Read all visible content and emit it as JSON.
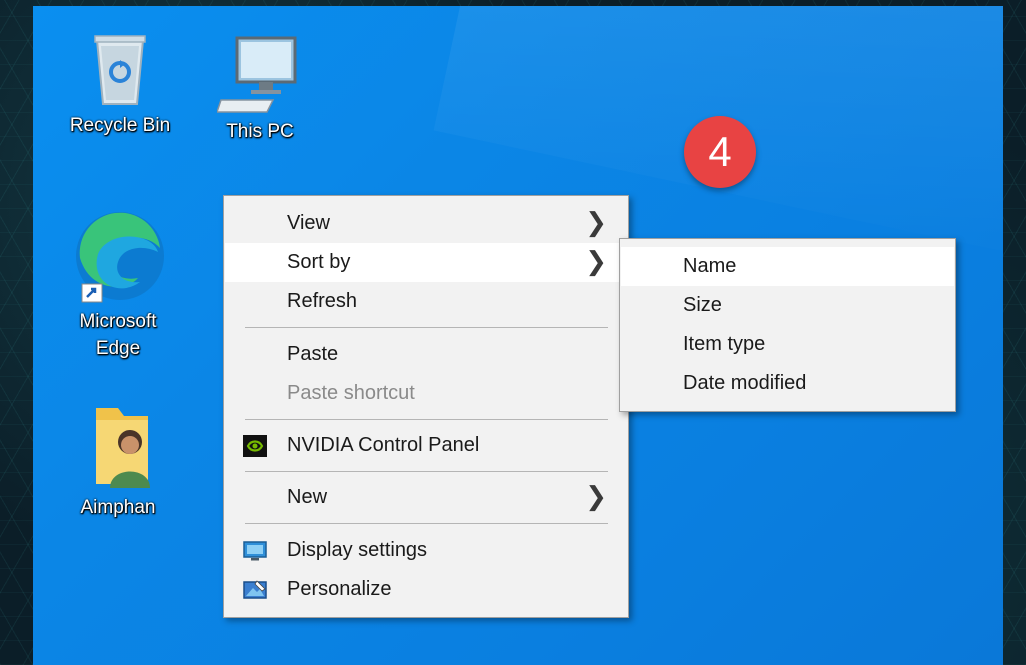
{
  "desktop_icons": [
    {
      "label": "Recycle Bin",
      "icon": "recycle-bin-icon"
    },
    {
      "label": "This PC",
      "icon": "computer-icon"
    },
    {
      "label": "Microsoft Edge",
      "icon": "edge-icon"
    },
    {
      "label": "Aimphan",
      "icon": "user-folder-icon"
    }
  ],
  "edge_label_line1": "Microsoft",
  "edge_label_line2": "Edge",
  "step_badge": "4",
  "context_menu": {
    "view": "View",
    "sort_by": "Sort by",
    "refresh": "Refresh",
    "paste": "Paste",
    "paste_shortcut": "Paste shortcut",
    "nvidia": "NVIDIA Control Panel",
    "new": "New",
    "display_settings": "Display settings",
    "personalize": "Personalize"
  },
  "sort_submenu": {
    "name": "Name",
    "size": "Size",
    "item_type": "Item type",
    "date_modified": "Date modified"
  },
  "colors": {
    "desktop": "#0a86e6",
    "badge": "#e84343",
    "menu_bg": "#f2f2f2",
    "menu_hover": "#ffffff"
  }
}
